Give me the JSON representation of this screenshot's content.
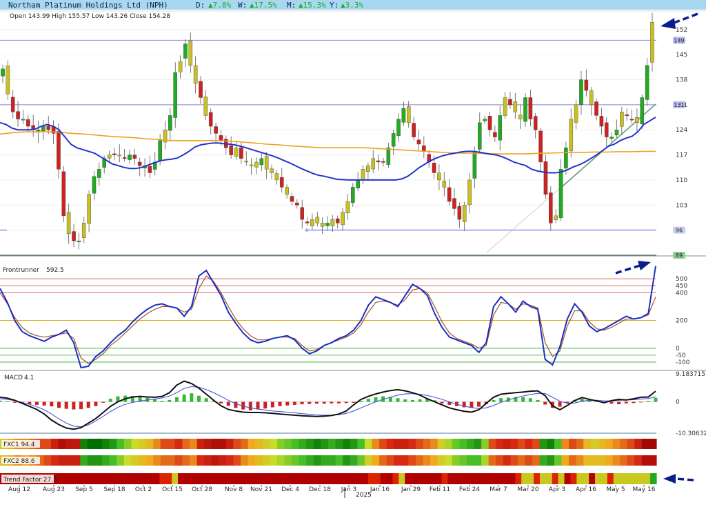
{
  "header": {
    "title": "Northam Platinum Holdings Ltd (NPH)",
    "d_label": "D:",
    "d_value": "▲7.8%",
    "w_label": "W:",
    "w_value": "▲17.5%",
    "m_label": "M:",
    "m_value": "▲15.3%",
    "y_label": "Y:",
    "y_value": "▲3.3%",
    "ohlc": "Open 143.99  High 155.57  Low 143.26  Close 154.28"
  },
  "colors": {
    "up": "#22aa22",
    "down": "#cc2222",
    "neutral": "#c8c020",
    "ma_fast": "#2233cc",
    "ma_slow": "#f0a020",
    "header_bg": "#a8d8f0",
    "arrow": "#0a1e8a"
  },
  "chart_data": [
    {
      "type": "candlestick",
      "title": "Northam Platinum Holdings Ltd (NPH)",
      "ylim": [
        89,
        156
      ],
      "yticks": [
        152,
        145,
        138,
        131,
        124,
        117,
        110,
        103,
        96,
        89
      ],
      "markers": [
        149,
        131,
        96,
        89
      ],
      "latest": {
        "open": 143.99,
        "high": 155.57,
        "low": 143.26,
        "close": 154.28
      },
      "xticks": [
        "Aug 12",
        "Aug 23",
        "Sep 5",
        "Sep 18",
        "Oct 2",
        "Oct 15",
        "Oct 28",
        "Nov 8",
        "Nov 21",
        "Dec 4",
        "Dec 18",
        "Jan 3",
        "Jan 16",
        "Jan 29",
        "Feb 11",
        "Feb 24",
        "Mar 7",
        "Mar 20",
        "Apr 3",
        "Apr 16",
        "May 5",
        "May 16"
      ],
      "year_label": "2025",
      "close_path": [
        141,
        134,
        129,
        127,
        127,
        125,
        124,
        124,
        125,
        124,
        123,
        113,
        100,
        95,
        93,
        93,
        98,
        106,
        111,
        113,
        116,
        117,
        117,
        117,
        116,
        117,
        116,
        114,
        114,
        112,
        115,
        121,
        124,
        128,
        140,
        143,
        148,
        142,
        137,
        133,
        128,
        125,
        123,
        121,
        119,
        117,
        119,
        116,
        115,
        114,
        115,
        116,
        113,
        112,
        110,
        108,
        106,
        104,
        103,
        99,
        98,
        99,
        98,
        98,
        98,
        99,
        98,
        101,
        104,
        108,
        110,
        113,
        114,
        116,
        115,
        115,
        119,
        123,
        127,
        130,
        126,
        122,
        120,
        118,
        115,
        112,
        110,
        108,
        104,
        102,
        99,
        103,
        110,
        118,
        126,
        127,
        124,
        122,
        128,
        133,
        131,
        129,
        127,
        133,
        127,
        124,
        115,
        106,
        98,
        100,
        113,
        119,
        127,
        131,
        138,
        135,
        131,
        128,
        125,
        122,
        122,
        124,
        129,
        128,
        127,
        126,
        133,
        142,
        154
      ],
      "ma_fast": [
        126,
        125.5,
        124.5,
        124,
        124,
        124,
        124.2,
        125,
        125.5,
        125,
        124,
        122,
        120,
        119,
        118.5,
        118,
        117.5,
        116.5,
        115.5,
        114.5,
        114,
        113.5,
        113.2,
        113.2,
        113.5,
        114.1,
        114.7,
        115.3,
        115.6,
        115.8,
        116.1,
        117,
        118,
        119.2,
        119.8,
        120.1,
        120.3,
        120.3,
        120.1,
        120,
        119.7,
        119.3,
        118.8,
        118.3,
        117.8,
        117.3,
        116.8,
        116.2,
        115.5,
        114.8,
        114,
        113.2,
        112.5,
        111.8,
        111.3,
        111,
        110.6,
        110.2,
        110.1,
        110,
        110,
        110,
        110,
        110,
        110,
        110,
        110,
        110,
        110.3,
        111,
        112.2,
        113.5,
        114.5,
        115.5,
        116.2,
        116.8,
        117.2,
        117.5,
        117.8,
        118,
        118,
        117.8,
        117.5,
        117.2,
        117,
        116.5,
        115.8,
        115,
        114.5,
        114,
        113,
        112.5,
        112.2,
        112,
        112,
        112.2,
        112.8,
        113.6,
        114.2,
        115,
        116,
        117,
        118.2,
        119.4,
        120,
        121,
        121.7,
        122.2,
        123.5,
        125.5,
        126.5,
        127.5
      ],
      "ma_slow": [
        122.8,
        123.2,
        123.4,
        123.5,
        123.5,
        123.3,
        123,
        122.8,
        122.5,
        122.2,
        122,
        121.8,
        121.5,
        121.3,
        121,
        121,
        121,
        121,
        121,
        120.8,
        120.6,
        120.3,
        120,
        119.8,
        119.5,
        119.3,
        119.1,
        119,
        119,
        119,
        119,
        118.8,
        118.6,
        118.4,
        118.2,
        118,
        117.8,
        117.6,
        117.5,
        117.5,
        117.4,
        117.3,
        117.3,
        117.3,
        117.4,
        117.5,
        117.6,
        117.7,
        117.7,
        117.8,
        117.8,
        117.9,
        117.9,
        118,
        118
      ],
      "sub_levels": [
        "149",
        "131"
      ]
    },
    {
      "type": "line",
      "title": "Frontrunner",
      "value_label": "592.5",
      "levels": [
        500,
        450,
        400,
        200,
        0,
        -50,
        -100
      ],
      "ylim": [
        -135,
        610
      ],
      "series": [
        {
          "name": "Frontrunner",
          "color": "#1a2fc0",
          "values": [
            430,
            330,
            200,
            120,
            90,
            70,
            50,
            80,
            100,
            130,
            40,
            -140,
            -130,
            -60,
            -20,
            40,
            90,
            130,
            190,
            240,
            280,
            310,
            320,
            300,
            290,
            230,
            300,
            520,
            560,
            470,
            380,
            260,
            180,
            110,
            60,
            40,
            50,
            70,
            80,
            90,
            60,
            0,
            -40,
            -20,
            20,
            40,
            70,
            90,
            130,
            200,
            310,
            370,
            350,
            330,
            300,
            380,
            460,
            430,
            380,
            250,
            150,
            80,
            60,
            40,
            20,
            -30,
            40,
            300,
            370,
            320,
            260,
            340,
            300,
            280,
            -80,
            -120,
            10,
            210,
            320,
            260,
            160,
            120,
            140,
            170,
            200,
            230,
            210,
            220,
            250,
            592
          ]
        },
        {
          "name": "Signal",
          "color": "#a0522d",
          "values": [
            400,
            320,
            220,
            150,
            110,
            90,
            80,
            90,
            100,
            110,
            70,
            -70,
            -110,
            -80,
            -40,
            20,
            60,
            110,
            160,
            210,
            250,
            280,
            300,
            300,
            290,
            260,
            280,
            430,
            520,
            480,
            400,
            300,
            210,
            140,
            90,
            60,
            60,
            70,
            80,
            80,
            70,
            20,
            -20,
            -10,
            20,
            40,
            60,
            80,
            110,
            170,
            260,
            330,
            340,
            330,
            310,
            350,
            420,
            430,
            400,
            300,
            190,
            110,
            70,
            50,
            30,
            0,
            20,
            240,
            330,
            320,
            280,
            320,
            310,
            290,
            40,
            -60,
            -20,
            160,
            270,
            270,
            190,
            140,
            130,
            150,
            180,
            210,
            210,
            220,
            240,
            370
          ]
        }
      ]
    },
    {
      "type": "bar+line",
      "title": "MACD",
      "value_label": "4.1",
      "ylim": [
        -10.3063,
        9.1837
      ],
      "labels": [
        "9.183715",
        "0",
        "-10.30632"
      ],
      "histogram": [
        0.4,
        0.2,
        -0.3,
        -0.6,
        -0.8,
        -1,
        -1.2,
        -1.5,
        -2,
        -2.3,
        -2.5,
        -2.4,
        -2,
        -1.4,
        -0.3,
        1,
        1.8,
        2,
        1.9,
        1.7,
        1.3,
        0.8,
        0.3,
        0.6,
        1.5,
        2.4,
        2.8,
        2,
        1.2,
        0.3,
        -0.5,
        -1.3,
        -2,
        -2.5,
        -2.8,
        -2.5,
        -2.2,
        -1.8,
        -1.4,
        -1.2,
        -1,
        -0.8,
        -0.7,
        -0.6,
        -0.6,
        -0.5,
        -0.5,
        -0.4,
        -0.3,
        0.3,
        1,
        1.5,
        1.8,
        1.6,
        1.2,
        0.8,
        0.6,
        0.8,
        1.1,
        0.5,
        -0.5,
        -1,
        -1.4,
        -1.8,
        -2,
        -1.6,
        -0.8,
        0.6,
        1.2,
        1.4,
        1.6,
        1.5,
        1.2,
        0.6,
        -0.9,
        -2,
        -1.6,
        -0.4,
        0.6,
        1,
        0.6,
        0.3,
        -0.3,
        -0.6,
        -0.8,
        -0.5,
        -0.4,
        -0.2,
        0.3,
        1.3
      ],
      "series": [
        {
          "name": "MACD",
          "color": "#111111",
          "values": [
            1.5,
            1.2,
            0.5,
            -0.5,
            -1.5,
            -2.5,
            -4,
            -6,
            -7.5,
            -8.6,
            -9,
            -8.5,
            -7,
            -5.5,
            -3.5,
            -1.5,
            0,
            1,
            1.6,
            1.8,
            1.6,
            1.5,
            1.8,
            3,
            5.5,
            6.8,
            6,
            4.5,
            2.5,
            0.5,
            -1.3,
            -2.5,
            -3,
            -3.4,
            -3.5,
            -3.5,
            -3.6,
            -3.8,
            -4,
            -4.2,
            -4.4,
            -4.6,
            -4.7,
            -4.8,
            -4.7,
            -4.5,
            -4,
            -3,
            -1,
            0.8,
            1.8,
            2.6,
            3.2,
            3.7,
            4,
            3.6,
            3,
            2.2,
            1,
            0,
            -1,
            -2,
            -2.6,
            -3.1,
            -3.4,
            -2.6,
            -0.5,
            1.5,
            2.5,
            2.8,
            3,
            3.2,
            3.5,
            3.6,
            2,
            -1.3,
            -2.6,
            -1.2,
            0.4,
            1.4,
            0.8,
            0.3,
            -0.3,
            0.4,
            0.8,
            0.6,
            1,
            1.5,
            1.6,
            3.5
          ]
        },
        {
          "name": "Signal",
          "color": "#4455dd",
          "values": [
            1,
            0.8,
            0.4,
            -0.2,
            -0.8,
            -1.6,
            -2.6,
            -4,
            -5.6,
            -7,
            -8,
            -8.2,
            -7.6,
            -6.3,
            -4.8,
            -3.2,
            -1.8,
            -0.8,
            -0.2,
            0.3,
            0.6,
            0.9,
            1.3,
            1.9,
            3,
            4.4,
            5,
            4.8,
            4,
            3,
            1.8,
            0.5,
            -0.6,
            -1.4,
            -2,
            -2.4,
            -2.7,
            -3,
            -3.2,
            -3.4,
            -3.6,
            -3.9,
            -4.1,
            -4.3,
            -4.4,
            -4.4,
            -4.2,
            -3.8,
            -3,
            -2,
            -1,
            0,
            0.8,
            1.5,
            2.2,
            2.6,
            2.7,
            2.5,
            2.1,
            1.5,
            0.8,
            0,
            -0.8,
            -1.4,
            -1.9,
            -2.2,
            -2,
            -1.2,
            -0.2,
            0.6,
            1.3,
            1.9,
            2.4,
            2.8,
            2.7,
            1.5,
            0.2,
            -0.5,
            -0.4,
            0.2,
            0.5,
            0.5,
            0.3,
            0.3,
            0.5,
            0.6,
            0.7,
            0.9,
            1.1,
            1.6
          ]
        }
      ]
    }
  ],
  "strips": [
    {
      "label": "FXC1 94.4",
      "values": [
        0.55,
        0.45,
        0.4,
        0.4,
        0.35,
        0.3,
        0.3,
        0.2,
        0.1,
        0.15,
        0.15,
        0.95,
        1,
        1,
        0.95,
        0.9,
        0.8,
        0.7,
        0.6,
        0.55,
        0.5,
        0.4,
        0.3,
        0.3,
        0.25,
        0.35,
        0.4,
        0.2,
        0.15,
        0.1,
        0.1,
        0.2,
        0.3,
        0.35,
        0.45,
        0.5,
        0.55,
        0.6,
        0.7,
        0.75,
        0.8,
        0.85,
        0.9,
        0.95,
        0.9,
        0.85,
        0.9,
        0.95,
        0.9,
        0.8,
        0.6,
        0.4,
        0.3,
        0.25,
        0.2,
        0.2,
        0.25,
        0.3,
        0.35,
        0.4,
        0.55,
        0.65,
        0.75,
        0.8,
        0.85,
        0.9,
        0.7,
        0.3,
        0.25,
        0.2,
        0.25,
        0.3,
        0.25,
        0.3,
        0.9,
        0.95,
        0.8,
        0.4,
        0.3,
        0.35,
        0.5,
        0.55,
        0.5,
        0.45,
        0.4,
        0.35,
        0.3,
        0.2,
        0.05,
        0.05
      ]
    },
    {
      "label": "FXC2 88.6",
      "values": [
        0.5,
        0.45,
        0.4,
        0.45,
        0.4,
        0.35,
        0.3,
        0.25,
        0.2,
        0.2,
        0.2,
        0.85,
        0.9,
        0.9,
        0.85,
        0.8,
        0.7,
        0.6,
        0.55,
        0.5,
        0.45,
        0.4,
        0.35,
        0.35,
        0.3,
        0.35,
        0.4,
        0.25,
        0.2,
        0.15,
        0.2,
        0.25,
        0.3,
        0.4,
        0.45,
        0.5,
        0.55,
        0.6,
        0.65,
        0.7,
        0.75,
        0.8,
        0.85,
        0.9,
        0.85,
        0.85,
        0.8,
        0.9,
        0.85,
        0.75,
        0.55,
        0.45,
        0.35,
        0.3,
        0.25,
        0.25,
        0.3,
        0.35,
        0.4,
        0.45,
        0.55,
        0.6,
        0.7,
        0.75,
        0.8,
        0.8,
        0.65,
        0.35,
        0.3,
        0.25,
        0.3,
        0.35,
        0.3,
        0.35,
        0.85,
        0.9,
        0.75,
        0.45,
        0.35,
        0.4,
        0.5,
        0.5,
        0.5,
        0.45,
        0.4,
        0.35,
        0.3,
        0.25,
        0.1,
        0.1
      ]
    },
    {
      "label": "Trend Factor 27.5",
      "values": [
        0,
        0,
        0,
        0,
        0,
        0,
        0,
        0,
        0,
        0,
        0,
        0,
        0,
        0,
        0,
        0,
        0,
        0,
        0,
        0,
        0,
        0,
        0,
        0,
        0,
        0,
        0.5,
        0.5,
        1,
        0,
        0,
        0,
        0,
        0,
        0,
        0,
        0,
        0,
        0,
        0,
        0,
        0,
        0,
        0,
        0,
        0,
        0,
        0,
        0,
        0,
        0,
        0,
        0,
        0,
        0,
        0,
        0,
        0,
        0,
        0,
        0.5,
        0.5,
        0,
        0,
        0.5,
        1,
        0,
        0,
        0,
        0,
        0,
        0,
        0.5,
        0,
        0,
        0,
        0,
        0,
        0,
        0,
        0,
        0,
        0,
        0,
        0.5,
        1,
        1,
        0.5,
        1,
        1,
        0.5,
        1,
        0,
        0.5,
        1,
        1,
        0,
        1,
        1,
        0.5,
        1,
        1,
        1,
        1,
        1,
        1,
        2
      ]
    }
  ]
}
